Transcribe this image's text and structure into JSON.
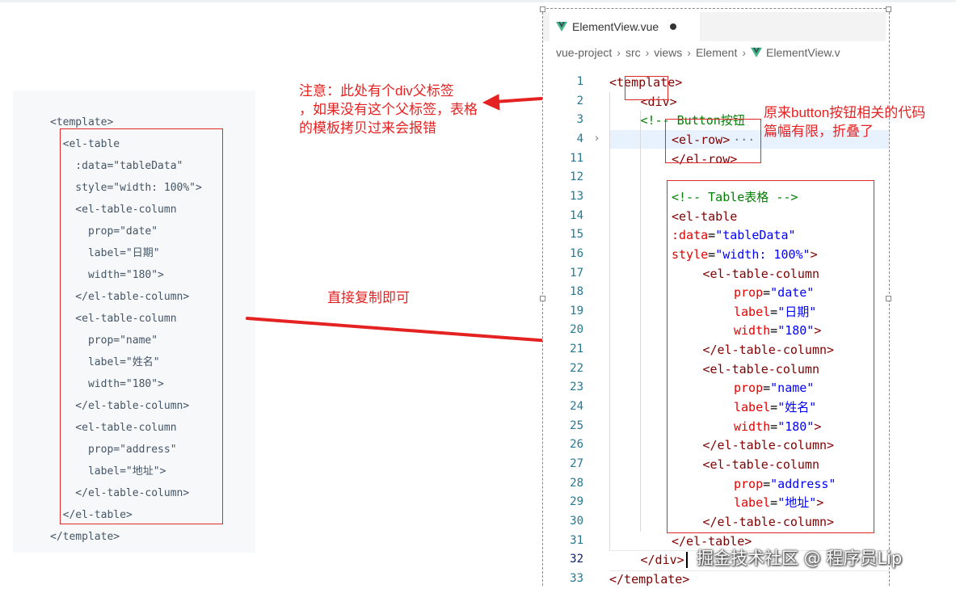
{
  "left_snippet": {
    "lines": [
      "<template>",
      "  <el-table",
      "    :data=\"tableData\"",
      "    style=\"width: 100%\">",
      "    <el-table-column",
      "      prop=\"date\"",
      "      label=\"日期\"",
      "      width=\"180\">",
      "    </el-table-column>",
      "    <el-table-column",
      "      prop=\"name\"",
      "      label=\"姓名\"",
      "      width=\"180\">",
      "    </el-table-column>",
      "    <el-table-column",
      "      prop=\"address\"",
      "      label=\"地址\">",
      "    </el-table-column>",
      "  </el-table>",
      "</template>"
    ]
  },
  "annotations": {
    "div_note": "注意：此处有个div父标签\n，如果没有这个父标签，表格\n的模板拷贝过来会报错",
    "copy_note": "直接复制即可",
    "fold_note": "原来button按钮相关的代码\n篇幅有限，折叠了"
  },
  "editor": {
    "tab_label": "ElementView.vue",
    "tab_icon": "vue-icon",
    "breadcrumb": [
      "vue-project",
      "src",
      "views",
      "Element",
      "ElementView.v"
    ],
    "line_numbers": [
      "1",
      "2",
      "3",
      "4",
      "11",
      "12",
      "13",
      "14",
      "15",
      "16",
      "17",
      "18",
      "19",
      "20",
      "21",
      "22",
      "23",
      "24",
      "25",
      "26",
      "27",
      "28",
      "29",
      "30",
      "31",
      "32",
      "33"
    ],
    "lines": {
      "l1": {
        "open": "<template>"
      },
      "l2": {
        "open": "<div>"
      },
      "l3": {
        "comment": "<!-- Button按钮"
      },
      "l4": {
        "open": "<el-row>",
        "ellipsis": "···"
      },
      "l11": {
        "open": "</el-row>"
      },
      "l13": {
        "comment": "<!-- Table表格 -->"
      },
      "l14": {
        "open": "<el-table"
      },
      "l15": {
        "attr": ":data",
        "eq": "=",
        "val": "\"tableData\""
      },
      "l16": {
        "attr": "style",
        "eq": "=",
        "val": "\"width: 100%\"",
        "close": ">"
      },
      "l17": {
        "open": "<el-table-column"
      },
      "l18": {
        "attr": "prop",
        "eq": "=",
        "val": "\"date\""
      },
      "l19": {
        "attr": "label",
        "eq": "=",
        "val": "\"日期\""
      },
      "l20": {
        "attr": "width",
        "eq": "=",
        "val": "\"180\"",
        "close": ">"
      },
      "l21": {
        "open": "</el-table-column>"
      },
      "l22": {
        "open": "<el-table-column"
      },
      "l23": {
        "attr": "prop",
        "eq": "=",
        "val": "\"name\""
      },
      "l24": {
        "attr": "label",
        "eq": "=",
        "val": "\"姓名\""
      },
      "l25": {
        "attr": "width",
        "eq": "=",
        "val": "\"180\"",
        "close": ">"
      },
      "l26": {
        "open": "</el-table-column>"
      },
      "l27": {
        "open": "<el-table-column"
      },
      "l28": {
        "attr": "prop",
        "eq": "=",
        "val": "\"address\""
      },
      "l29": {
        "attr": "label",
        "eq": "=",
        "val": "\"地址\"",
        "close": ">"
      },
      "l30": {
        "open": "</el-table-column>"
      },
      "l31": {
        "open": "</el-table>"
      },
      "l32": {
        "open": "</div>"
      },
      "l33": {
        "open": "</template>"
      }
    },
    "active_line": "32"
  },
  "watermark": "掘金技术社区 @ 程序员Lip",
  "colors": {
    "annotation_red": "#e52222",
    "tag": "#800000",
    "attribute": "#e50000",
    "string": "#0000ff",
    "comment": "#008000",
    "line_number": "#237893",
    "vue_green": "#41b883"
  }
}
